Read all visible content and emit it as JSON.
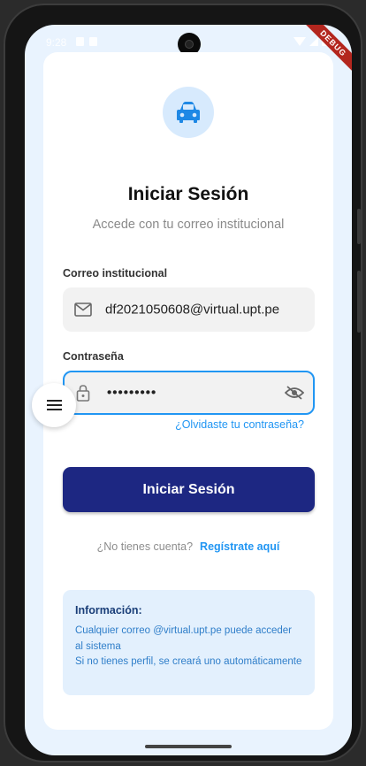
{
  "status_bar": {
    "time": "9:28",
    "debug_banner": "DEBUG"
  },
  "login": {
    "title": "Iniciar Sesión",
    "subtitle": "Accede con tu correo institucional",
    "email_label": "Correo institucional",
    "email_value": "df2021050608@virtual.upt.pe",
    "password_label": "Contraseña",
    "password_value": "•••••••••",
    "forgot_link": "¿Olvidaste tu contraseña?",
    "submit_label": "Iniciar Sesión",
    "no_account_text": "¿No tienes cuenta?",
    "register_link": "Regístrate aquí"
  },
  "info": {
    "title": "Información:",
    "line1": "Cualquier correo @virtual.upt.pe puede acceder al sistema",
    "line2": "Si no tienes perfil, se creará uno automáticamente"
  },
  "icons": {
    "logo": "car-icon",
    "email": "mail-icon",
    "password": "lock-icon",
    "visibility": "eye-off-icon",
    "menu": "menu-icon"
  },
  "colors": {
    "primary": "#1d2782",
    "accent": "#2196f3",
    "background": "#e9f3fe",
    "info_background": "#e3f0fd"
  }
}
